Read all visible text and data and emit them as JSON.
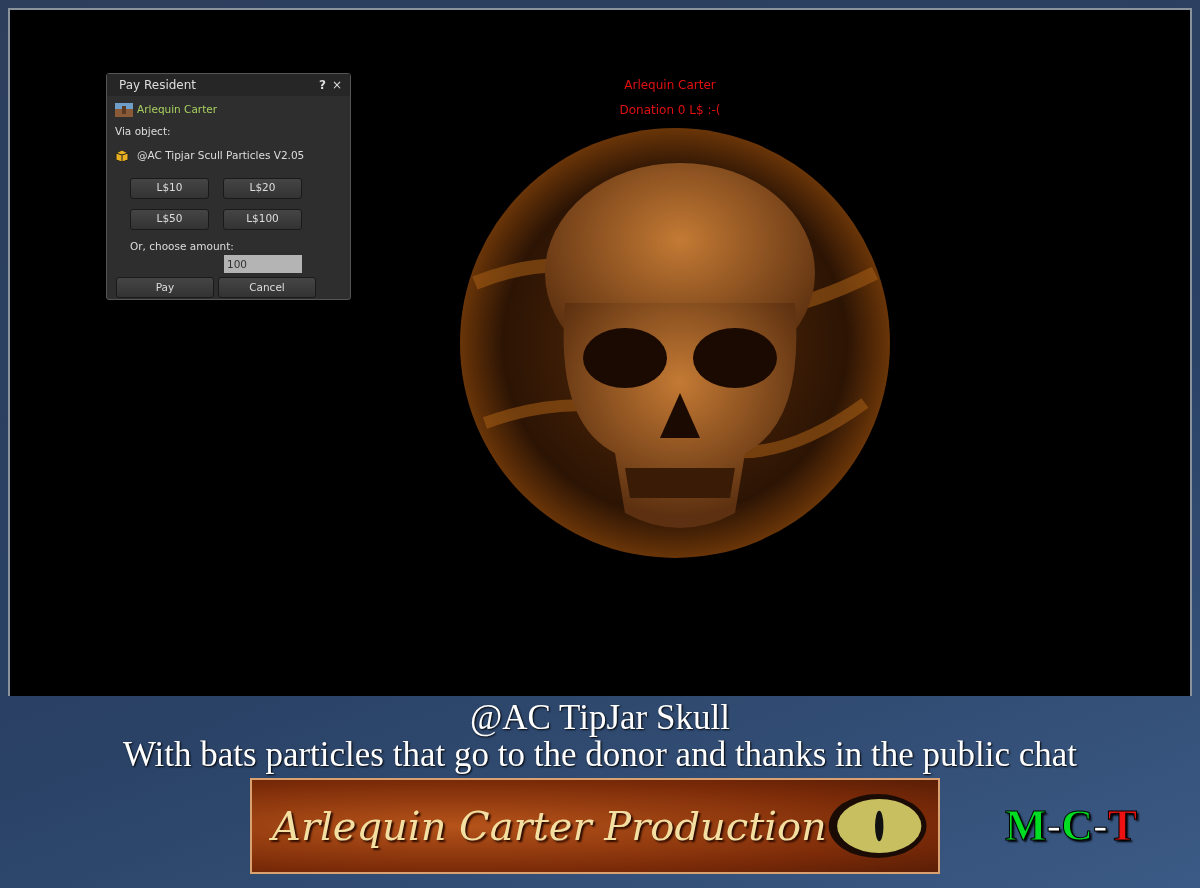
{
  "viewport": {
    "floating_text": [
      "Arlequin Carter",
      "Donation 0 L$ :-("
    ]
  },
  "pay_dialog": {
    "title": "Pay Resident",
    "help": "?",
    "close": "×",
    "payee": "Arlequin Carter",
    "via_label": "Via object:",
    "object_name": "@AC Tipjar Scull Particles V2.05",
    "quick_amounts": [
      "L$10",
      "L$20",
      "L$50",
      "L$100"
    ],
    "amount_label": "Or, choose amount:",
    "amount_value": "100",
    "buttons": [
      {
        "label": "Pay"
      },
      {
        "label": "Cancel"
      }
    ]
  },
  "caption": {
    "title": "@AC TipJar Skull",
    "subtitle": "With bats particles that go to the donor and thanks in the public chat"
  },
  "banner": {
    "text": "Arlequin Carter Production"
  },
  "mct_logo": [
    {
      "text": "M",
      "color": "#00dd22"
    },
    {
      "text": "-",
      "color": "#ffffff"
    },
    {
      "text": "C",
      "color": "#00dd22"
    },
    {
      "text": "-",
      "color": "#ffffff"
    },
    {
      "text": "T",
      "color": "#ee1111"
    }
  ]
}
